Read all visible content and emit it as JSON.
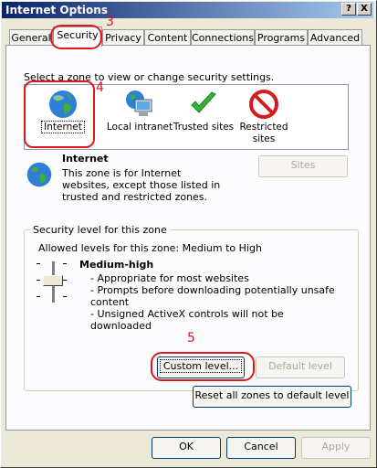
{
  "window": {
    "title": "Internet Options",
    "help_glyph": "?",
    "close_glyph": "X"
  },
  "tabs": [
    {
      "label": "General"
    },
    {
      "label": "Security"
    },
    {
      "label": "Privacy"
    },
    {
      "label": "Content"
    },
    {
      "label": "Connections"
    },
    {
      "label": "Programs"
    },
    {
      "label": "Advanced"
    }
  ],
  "security": {
    "instruction": "Select a zone to view or change security settings.",
    "zones": [
      {
        "label": "Internet",
        "icon": "globe-icon"
      },
      {
        "label": "Local intranet",
        "icon": "intranet-computer-icon"
      },
      {
        "label": "Trusted sites",
        "icon": "checkmark-icon"
      },
      {
        "label": "Restricted sites",
        "icon": "no-entry-icon"
      }
    ],
    "selected_zone": {
      "name": "Internet",
      "description": "This zone is for Internet websites, except those listed in trusted and restricted zones."
    },
    "sites_button": "Sites",
    "level_group": {
      "title": "Security level for this zone",
      "allowed": "Allowed levels for this zone: Medium to High",
      "level_name": "Medium-high",
      "bullets": [
        "- Appropriate for most websites",
        "- Prompts before downloading potentially unsafe content",
        "- Unsigned ActiveX controls will not be downloaded"
      ],
      "custom_button": "Custom level...",
      "default_button": "Default level"
    },
    "reset_button": "Reset all zones to default level"
  },
  "dialog_buttons": {
    "ok": "OK",
    "cancel": "Cancel",
    "apply": "Apply"
  },
  "annotations": {
    "n3": "3",
    "n4": "4",
    "n5": "5"
  },
  "colors": {
    "annotation_red": "#e0161b",
    "title_blue": "#0a246a"
  }
}
